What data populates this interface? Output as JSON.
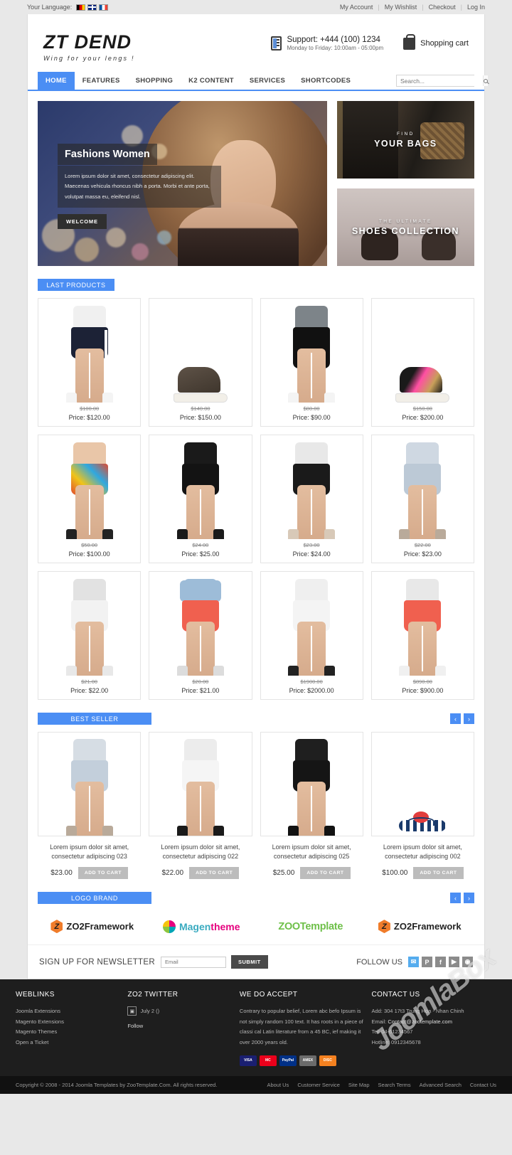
{
  "topbar": {
    "language_label": "Your Language:",
    "flags": [
      "german-flag",
      "uk-flag",
      "france-flag"
    ],
    "links": [
      "My Account",
      "My Wishlist",
      "Checkout",
      "Log In"
    ]
  },
  "header": {
    "logo_main": "ZT DEND",
    "logo_sub": "Wing for your lengs !",
    "support_line1": "Support: +444 (100) 1234",
    "support_line2": "Monday to Friday: 10:00am - 05:00pm",
    "cart_label": "Shopping cart"
  },
  "nav": {
    "items": [
      "HOME",
      "FEATURES",
      "SHOPPING",
      "K2 CONTENT",
      "SERVICES",
      "SHORTCODES"
    ],
    "active": "HOME",
    "search_placeholder": "Search..."
  },
  "hero": {
    "main": {
      "title": "Fashions Women",
      "text": "Lorem ipsum dolor sit amet, consectetur adipiscing elit. Maecenas vehicula rhoncus nibh a porta. Morbi et ante porta, volutpat massa eu, eleifend nisl.",
      "button": "WELCOME"
    },
    "side": [
      {
        "small": "FIND",
        "big": "YOUR BAGS"
      },
      {
        "small": "THE ULTIMATE",
        "big": "SHOES COLLECTION"
      }
    ]
  },
  "last_products": {
    "title": "LAST PRODUCTS",
    "price_prefix": "Price: ",
    "items": [
      {
        "old_price": "$100.00",
        "price": "$120.00",
        "kind": "shorts-navy"
      },
      {
        "old_price": "$140.00",
        "price": "$150.00",
        "kind": "sneaker-brown"
      },
      {
        "old_price": "$80.00",
        "price": "$90.00",
        "kind": "shorts-black-tight"
      },
      {
        "old_price": "$150.00",
        "price": "$200.00",
        "kind": "sneaker-pink"
      },
      {
        "old_price": "$50.00",
        "price": "$100.00",
        "kind": "shorts-floral"
      },
      {
        "old_price": "$24.00",
        "price": "$25.00",
        "kind": "shorts-black"
      },
      {
        "old_price": "$23.00",
        "price": "$24.00",
        "kind": "shorts-skull"
      },
      {
        "old_price": "$22.00",
        "price": "$23.00",
        "kind": "shorts-denim"
      },
      {
        "old_price": "$21.00",
        "price": "$22.00",
        "kind": "shorts-white"
      },
      {
        "old_price": "$20.00",
        "price": "$21.00",
        "kind": "skirt-coral-jacket"
      },
      {
        "old_price": "$1900.00",
        "price": "$2000.00",
        "kind": "shorts-white2"
      },
      {
        "old_price": "$890.00",
        "price": "$900.00",
        "kind": "skirt-coral"
      }
    ]
  },
  "best_seller": {
    "title": "BEST SELLER",
    "prev": "‹",
    "next": "›",
    "cart_label": "ADD TO CART",
    "items": [
      {
        "name": "Lorem ipsum dolor sit amet, consectetur adipiscing 023",
        "price": "$23.00",
        "kind": "denim-boots"
      },
      {
        "name": "Lorem ipsum dolor sit amet, consectetur adipiscing 022",
        "price": "$22.00",
        "kind": "white-heels"
      },
      {
        "name": "Lorem ipsum dolor sit amet, consectetur adipiscing 025",
        "price": "$25.00",
        "kind": "black-booties"
      },
      {
        "name": "Lorem ipsum dolor sit amet, consectetur adipiscing 002",
        "price": "$100.00",
        "kind": "sandal"
      }
    ]
  },
  "logo_brand": {
    "title": "LOGO BRAND",
    "prev": "‹",
    "next": "›",
    "items": [
      {
        "type": "zo2",
        "text": "ZO2Framework"
      },
      {
        "type": "magentheme",
        "text_a": "Magen",
        "text_b": "theme"
      },
      {
        "type": "zootemplate",
        "text": "ZOOTemplate"
      },
      {
        "type": "zo2",
        "text": "ZO2Framework"
      }
    ]
  },
  "newsletter": {
    "label": "SIGN UP FOR NEWSLETTER",
    "placeholder": "Email",
    "submit": "SUBMIT",
    "follow_label": "FOLLOW US",
    "socials": [
      "twitter-icon",
      "pinterest-icon",
      "facebook-icon",
      "youtube-icon",
      "rss-icon"
    ],
    "social_glyphs": [
      "✉",
      "P",
      "f",
      "▶",
      "◉"
    ]
  },
  "footer": {
    "weblinks": {
      "title": "WEBLINKS",
      "items": [
        "Joomla Extensions",
        "Magento Extensions",
        "Magento Themes",
        "Open a Ticket"
      ]
    },
    "twitter": {
      "title": "ZO2 TWITTER",
      "date": "July 2 ()",
      "follow": "Follow"
    },
    "accept": {
      "title": "WE DO ACCEPT",
      "text": "Contrary to popular belief, Lorem abc befo Ipsum is not simply random 100 text. It has roots in a piece of classi cal Latin literature from a 45 BC, ief making it over 2000 years old.",
      "cards": [
        "VISA",
        "MC",
        "PayPal",
        "AMEX",
        "DISC"
      ]
    },
    "contact": {
      "title": "CONTACT US",
      "address": "Add: 304 17t3 Trung Hoa - Nhan Chinh",
      "email_label": "Email: ",
      "email": "Contact@zootemplate.com",
      "tel": "Tel: 04-61234567",
      "hotline": "Hotline: 0912345678"
    }
  },
  "copyright": {
    "text": "Copyright © 2008 - 2014 Joomla Templates by ZooTemplate.Com. All rights reserved.",
    "links": [
      "About Us",
      "Customer Service",
      "Site Map",
      "Search Terms",
      "Advanced Search",
      "Contact Us"
    ]
  },
  "watermark": "JoomlaBox"
}
